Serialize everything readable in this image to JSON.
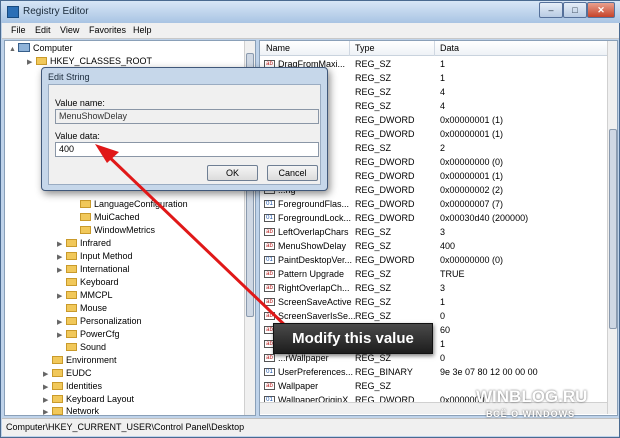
{
  "window": {
    "title": "Registry Editor",
    "min": "–",
    "max": "□",
    "close": "✕"
  },
  "menu": [
    "File",
    "Edit",
    "View",
    "Favorites",
    "Help"
  ],
  "tree": [
    {
      "label": "Computer",
      "exp": "▲",
      "icon": "computer"
    },
    {
      "label": "HKEY_CLASSES_ROOT",
      "exp": "▶",
      "icon": "folder"
    },
    {
      "label": "Infrared",
      "exp": "▶",
      "icon": "folder"
    },
    {
      "label": "LanguageConfiguration",
      "exp": "",
      "icon": "folder"
    },
    {
      "label": "MuiCached",
      "exp": "",
      "icon": "folder"
    },
    {
      "label": "WindowMetrics",
      "exp": "",
      "icon": "folder"
    },
    {
      "label": "Infrared",
      "exp": "▶",
      "icon": "folder"
    },
    {
      "label": "Input Method",
      "exp": "▶",
      "icon": "folder"
    },
    {
      "label": "International",
      "exp": "▶",
      "icon": "folder"
    },
    {
      "label": "Keyboard",
      "exp": "",
      "icon": "folder"
    },
    {
      "label": "MMCPL",
      "exp": "▶",
      "icon": "folder"
    },
    {
      "label": "Mouse",
      "exp": "",
      "icon": "folder"
    },
    {
      "label": "Personalization",
      "exp": "▶",
      "icon": "folder"
    },
    {
      "label": "PowerCfg",
      "exp": "▶",
      "icon": "folder"
    },
    {
      "label": "Sound",
      "exp": "",
      "icon": "folder"
    },
    {
      "label": "Environment",
      "exp": "",
      "icon": "folder"
    },
    {
      "label": "EUDC",
      "exp": "▶",
      "icon": "folder"
    },
    {
      "label": "Identities",
      "exp": "▶",
      "icon": "folder"
    },
    {
      "label": "Keyboard Layout",
      "exp": "▶",
      "icon": "folder"
    },
    {
      "label": "Network",
      "exp": "▶",
      "icon": "folder"
    }
  ],
  "columns": {
    "name": "Name",
    "type": "Type",
    "data": "Data"
  },
  "rows": [
    {
      "name": "DragFromMaxi...",
      "type": "REG_SZ",
      "data": "1",
      "kind": "sz"
    },
    {
      "name": "...ows",
      "type": "REG_SZ",
      "data": "1",
      "kind": "sz"
    },
    {
      "name": "",
      "type": "REG_SZ",
      "data": "4",
      "kind": "sz"
    },
    {
      "name": "",
      "type": "REG_SZ",
      "data": "4",
      "kind": "sz"
    },
    {
      "name": "...lei...",
      "type": "REG_DWORD",
      "data": "0x00000001 (1)",
      "kind": "dw"
    },
    {
      "name": "...Vid...",
      "type": "REG_DWORD",
      "data": "0x00000001 (1)",
      "kind": "dw"
    },
    {
      "name": "...ng",
      "type": "REG_SZ",
      "data": "2",
      "kind": "sz"
    },
    {
      "name": "...ng",
      "type": "REG_DWORD",
      "data": "0x00000000 (0)",
      "kind": "dw"
    },
    {
      "name": "...ng",
      "type": "REG_DWORD",
      "data": "0x00000001 (1)",
      "kind": "dw"
    },
    {
      "name": "...ng",
      "type": "REG_DWORD",
      "data": "0x00000002 (2)",
      "kind": "dw"
    },
    {
      "name": "ForegroundFlas...",
      "type": "REG_DWORD",
      "data": "0x00000007 (7)",
      "kind": "dw"
    },
    {
      "name": "ForegroundLock...",
      "type": "REG_DWORD",
      "data": "0x00030d40 (200000)",
      "kind": "dw"
    },
    {
      "name": "LeftOverlapChars",
      "type": "REG_SZ",
      "data": "3",
      "kind": "sz"
    },
    {
      "name": "MenuShowDelay",
      "type": "REG_SZ",
      "data": "400",
      "kind": "sz"
    },
    {
      "name": "PaintDesktopVer...",
      "type": "REG_DWORD",
      "data": "0x00000000 (0)",
      "kind": "dw"
    },
    {
      "name": "Pattern Upgrade",
      "type": "REG_SZ",
      "data": "TRUE",
      "kind": "sz"
    },
    {
      "name": "RightOverlapCh...",
      "type": "REG_SZ",
      "data": "3",
      "kind": "sz"
    },
    {
      "name": "ScreenSaveActive",
      "type": "REG_SZ",
      "data": "1",
      "kind": "sz"
    },
    {
      "name": "ScreenSaverIsSe...",
      "type": "REG_SZ",
      "data": "0",
      "kind": "sz"
    },
    {
      "name": "",
      "type": "",
      "data": "60",
      "kind": "sz"
    },
    {
      "name": "",
      "type": "",
      "data": "1",
      "kind": "sz"
    },
    {
      "name": "...rWallpaper",
      "type": "REG_SZ",
      "data": "0",
      "kind": "sz"
    },
    {
      "name": "UserPreferences...",
      "type": "REG_BINARY",
      "data": "9e 3e 07 80 12 00 00 00",
      "kind": "dw"
    },
    {
      "name": "Wallpaper",
      "type": "REG_SZ",
      "data": "",
      "kind": "sz"
    },
    {
      "name": "WallpaperOriginX",
      "type": "REG_DWORD",
      "data": "0x0000000",
      "kind": "dw"
    }
  ],
  "status": "Computer\\HKEY_CURRENT_USER\\Control Panel\\Desktop",
  "dialog": {
    "title": "Edit String",
    "value_name_label": "Value name:",
    "value_name": "MenuShowDelay",
    "value_data_label": "Value data:",
    "value_data": "400",
    "ok": "OK",
    "cancel": "Cancel"
  },
  "callout": "Modify this value",
  "watermark": {
    "line1": "WINBLOG.RU",
    "line2": "ВСЁ О WINDOWS"
  },
  "colors": {
    "arrow": "#e01818",
    "window_frame": "#bfd3ea"
  }
}
